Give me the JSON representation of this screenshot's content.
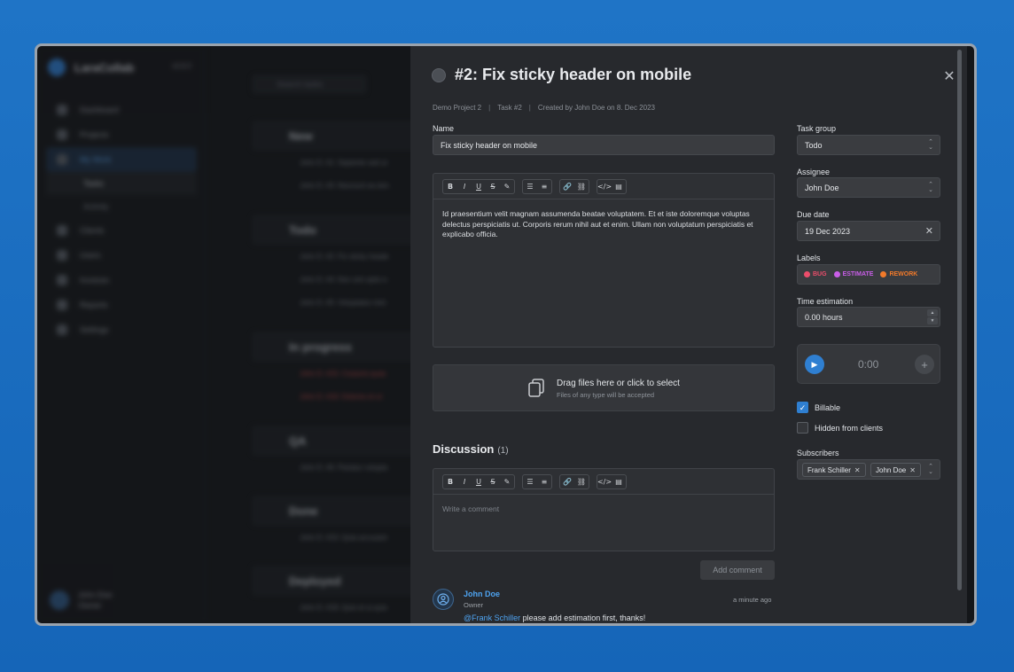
{
  "background_app": {
    "brand": "LaraCollab",
    "version": "v0.8.0",
    "nav": [
      {
        "label": "Dashboard"
      },
      {
        "label": "Projects"
      },
      {
        "label": "My Work",
        "active": true
      },
      {
        "label": "Tasks",
        "sub": true,
        "active": true
      },
      {
        "label": "Activity",
        "sub": true
      },
      {
        "label": "Clients"
      },
      {
        "label": "Users"
      },
      {
        "label": "Invoices"
      },
      {
        "label": "Reports"
      },
      {
        "label": "Settings"
      }
    ],
    "user_name": "John Doe",
    "user_role": "Owner",
    "search_placeholder": "Search tasks",
    "groups": [
      {
        "title": "New",
        "rows": [
          "John D. #1: Sapiente sed ut",
          "John D. #3: Nesciunt ea tem"
        ]
      },
      {
        "title": "Todo",
        "rows": [
          "John D. #2: Fix sticky heade",
          "John D. #4: Non sint optio e",
          "John D. #5: Voluptates mini"
        ]
      },
      {
        "title": "In progress",
        "rows": [
          "John D. #15: Corporis quas",
          "John D. #16: Dolores et ut"
        ]
      },
      {
        "title": "QA",
        "rows": [
          "John D. #6: Pariatur volupta"
        ]
      },
      {
        "title": "Done",
        "rows": [
          "John D. #10: Quia accusant"
        ]
      },
      {
        "title": "Deployed",
        "rows": [
          "John D. #18: Quis et ut quis"
        ]
      }
    ]
  },
  "task": {
    "title": "#2: Fix sticky header on mobile",
    "meta": {
      "project": "Demo Project 2",
      "task_ref": "Task #2",
      "created": "Created by John Doe on 8. Dec 2023"
    },
    "name_label": "Name",
    "name_value": "Fix sticky header on mobile",
    "description": "Id praesentium velit magnam assumenda beatae voluptatem. Et et iste doloremque voluptas delectus perspiciatis ut. Corporis rerum nihil aut et enim. Ullam non voluptatum perspiciatis et explicabo officia.",
    "toolbar": {
      "bold": "B",
      "italic": "I",
      "underline": "U",
      "strike": "S",
      "highlight": "✎",
      "bullet_list": "☰",
      "ordered_list": "≡",
      "link": "🔗",
      "unlink": "⛓",
      "code": "</>",
      "code_block": "▤"
    },
    "dropzone": {
      "title": "Drag files here or click to select",
      "subtitle": "Files of any type will be accepted"
    },
    "discussion": {
      "heading": "Discussion",
      "count": "(1)",
      "comment_placeholder": "Write a comment",
      "add_button": "Add comment",
      "comments": [
        {
          "author": "John Doe",
          "role": "Owner",
          "time": "a minute ago",
          "mention": "@Frank Schiller",
          "text": " please add estimation first, thanks!"
        }
      ]
    },
    "sidebar": {
      "task_group_label": "Task group",
      "task_group_value": "Todo",
      "assignee_label": "Assignee",
      "assignee_value": "John Doe",
      "due_date_label": "Due date",
      "due_date_value": "19 Dec 2023",
      "labels_label": "Labels",
      "labels": [
        {
          "name": "BUG",
          "color": "#ec4d6b"
        },
        {
          "name": "ESTIMATE",
          "color": "#c95ee8"
        },
        {
          "name": "REWORK",
          "color": "#f27a2a"
        }
      ],
      "time_estimation_label": "Time estimation",
      "time_estimation_value": "0.00 hours",
      "timer_value": "0:00",
      "billable_label": "Billable",
      "billable_checked": true,
      "hidden_label": "Hidden from clients",
      "hidden_checked": false,
      "subscribers_label": "Subscribers",
      "subscribers": [
        "Frank Schiller",
        "John Doe"
      ]
    }
  },
  "colors": {
    "accent": "#2f7fd1",
    "panel_bg": "#27292d",
    "page_bg": "#1f74c6"
  }
}
